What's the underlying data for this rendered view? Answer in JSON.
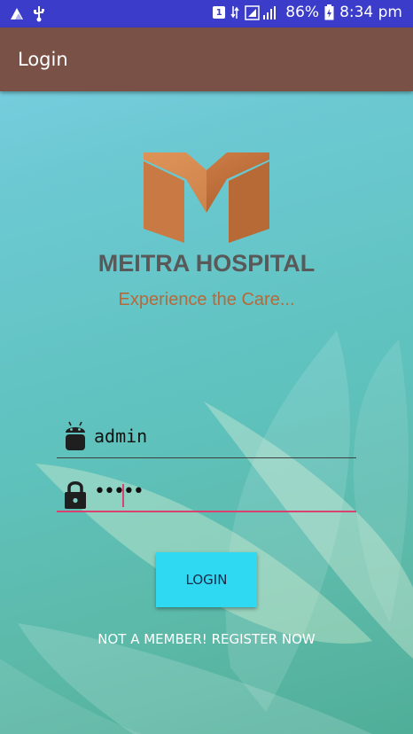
{
  "status_bar": {
    "battery_percent": "86%",
    "time": "8:34 pm",
    "sim_badge": "1",
    "icons": [
      "notification-icon",
      "usb-icon",
      "sim-icon",
      "data-icon",
      "signal-icon",
      "battery-icon"
    ]
  },
  "app_bar": {
    "title": "Login"
  },
  "brand": {
    "name": "MEITRA HOSPITAL",
    "tagline": "Experience the Care...",
    "logo_color": "#c9773f"
  },
  "form": {
    "username_value": "admin",
    "password_value": "•••••",
    "username_icon": "android-icon",
    "password_icon": "lock-icon"
  },
  "buttons": {
    "login_label": "LOGIN"
  },
  "links": {
    "register_label": "NOT A MEMBER! REGISTER NOW"
  },
  "colors": {
    "status_bar": "#3b3cc9",
    "app_bar": "#7a5146",
    "button": "#2fd9f2",
    "accent": "#d9426e"
  }
}
